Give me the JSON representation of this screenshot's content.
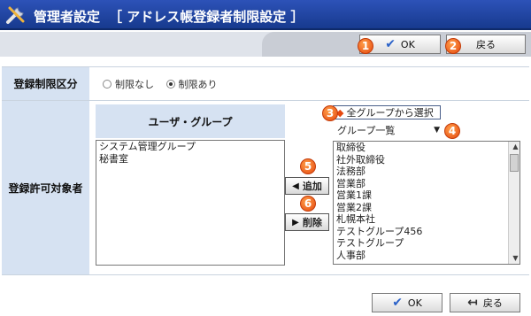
{
  "header": {
    "title": "管理者設定",
    "subtitle": "［ アドレス帳登録者制限設定 ］"
  },
  "toolbar": {
    "ok_label": "OK",
    "back_label": "戻る"
  },
  "markers": [
    "1",
    "2",
    "3",
    "4",
    "5",
    "6"
  ],
  "form": {
    "restriction_label": "登録制限区分",
    "radio_none": "制限なし",
    "radio_yes": "制限あり",
    "selected": "制限あり",
    "target_label": "登録許可対象者",
    "user_group_header": "ユーザ・グループ",
    "selected_items": [
      "システム管理グループ",
      "秘書室"
    ],
    "select_all_groups": "全グループから選択",
    "group_dropdown_value": "グループ一覧",
    "available_groups": [
      "取締役",
      "社外取締役",
      "法務部",
      "営業部",
      "営業1課",
      "営業2課",
      "札幌本社",
      "テストグループ456",
      "テストグループ",
      "人事部"
    ],
    "add_label": "追加",
    "remove_label": "削除"
  },
  "footer": {
    "ok_label": "OK",
    "back_label": "戻る"
  },
  "colors": {
    "header_bg": "#1f45a5",
    "label_bg": "#d6e2f2",
    "marker": "#e5480f"
  }
}
